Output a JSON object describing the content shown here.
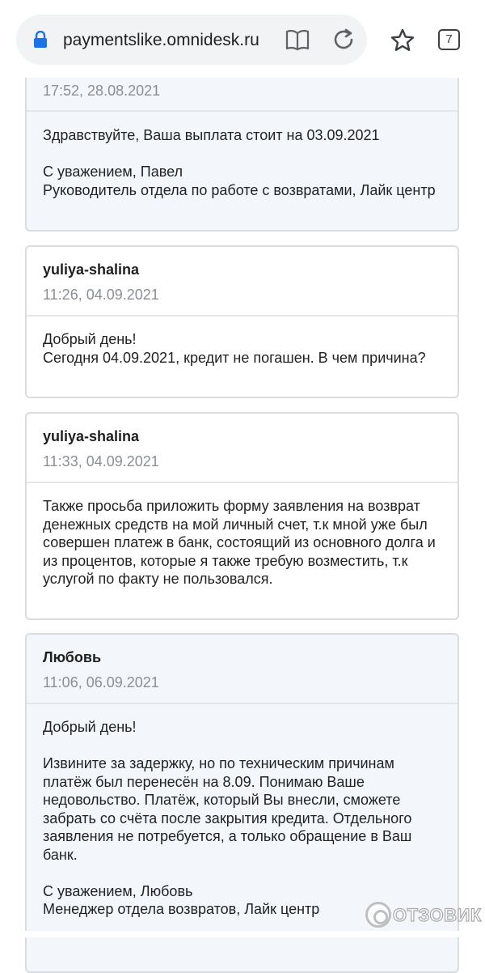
{
  "browser": {
    "url": "paymentslike.omnidesk.ru",
    "tab_count": "7"
  },
  "messages": [
    {
      "time": "17:52, 28.08.2021",
      "paragraphs": [
        [
          "Здравствуйте, Ваша выплата стоит на 03.09.2021"
        ],
        [
          "С уважением, Павел",
          "Руководитель отдела по работе с возвратами, Лайк центр"
        ]
      ]
    },
    {
      "author": "yuliya-shalina",
      "time": "11:26, 04.09.2021",
      "paragraphs": [
        [
          "Добрый день!",
          "Сегодня 04.09.2021, кредит не погашен. В чем причина?"
        ]
      ]
    },
    {
      "author": "yuliya-shalina",
      "time": "11:33, 04.09.2021",
      "paragraphs": [
        [
          "Также просьба приложить форму заявления на возврат денежных средств на мой личный счет, т.к мной уже был совершен платеж в банк, состоящий из основного долга и из процентов, которые я также требую возместить, т.к услугой по факту не пользовался."
        ]
      ]
    },
    {
      "author": "Любовь",
      "time": "11:06, 06.09.2021",
      "paragraphs": [
        [
          "Добрый день!"
        ],
        [
          "Извините за задержку, но по техническим причинам платёж был перенесён на 8.09. Понимаю Ваше недовольство. Платёж, который Вы внесли, сможете забрать со счёта после закрытия кредита. Отдельного заявления не потребуется, а только обращение в Ваш банк."
        ],
        [
          "С уважением, Любовь",
          "Менеджер отдела возвратов, Лайк центр"
        ]
      ]
    }
  ],
  "watermark": "ОТЗОВИК"
}
